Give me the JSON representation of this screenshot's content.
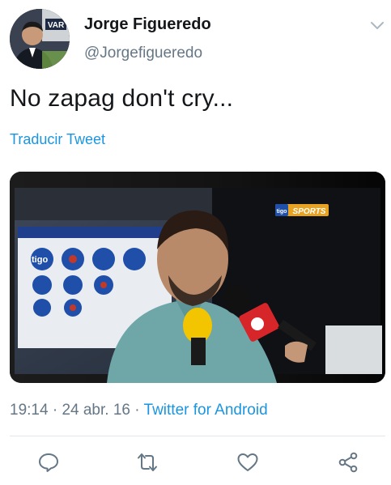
{
  "author": {
    "name": "Jorge Figueredo",
    "handle": "@Jorgefigueredo",
    "avatar_badge": "VAR"
  },
  "tweet": {
    "text": "No zapag don't cry...",
    "translate_label": "Traducir Tweet"
  },
  "media": {
    "channel_logo": "SPORTS",
    "channel_prefix": "tigo",
    "backdrop_brand": "tigo"
  },
  "meta": {
    "time": "19:14",
    "separator": "·",
    "date": "24 abr. 16",
    "source": "Twitter for Android"
  },
  "actions": [
    {
      "icon": "reply-icon"
    },
    {
      "icon": "retweet-icon"
    },
    {
      "icon": "like-icon"
    },
    {
      "icon": "share-icon"
    }
  ],
  "colors": {
    "link": "#1b95e0",
    "secondary": "#657786",
    "divider": "#e1e8ed"
  }
}
